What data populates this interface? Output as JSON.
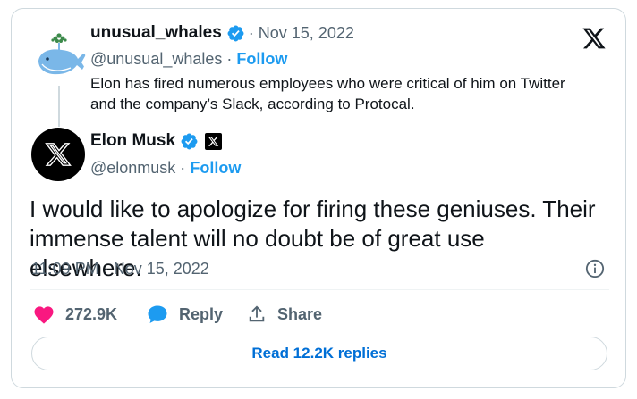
{
  "quoted": {
    "display_name": "unusual_whales",
    "date": "· Nov 15, 2022",
    "handle": "@unusual_whales ·",
    "follow": "Follow",
    "text": "Elon has fired numerous employees who were critical of him on Twitter and the company’s Slack, according to Protocal."
  },
  "tweet": {
    "display_name": "Elon Musk",
    "handle": "@elonmusk ·",
    "follow": "Follow",
    "text": "I would like to apologize for firing these geniuses. Their immense talent will no doubt be of great use elsewhere.",
    "timestamp": "11:09 PM · Nov 15, 2022"
  },
  "actions": {
    "likes": "272.9K",
    "reply": "Reply",
    "share": "Share"
  },
  "read_replies": "Read 12.2K replies",
  "colors": {
    "accent": "#1d9bf0",
    "like": "#f91880",
    "muted": "#536471",
    "border": "#cfd9de"
  },
  "icons": [
    "x-logo-icon",
    "verified-badge-icon",
    "x-affiliate-icon",
    "info-icon",
    "heart-icon",
    "reply-bubble-icon",
    "share-icon"
  ]
}
